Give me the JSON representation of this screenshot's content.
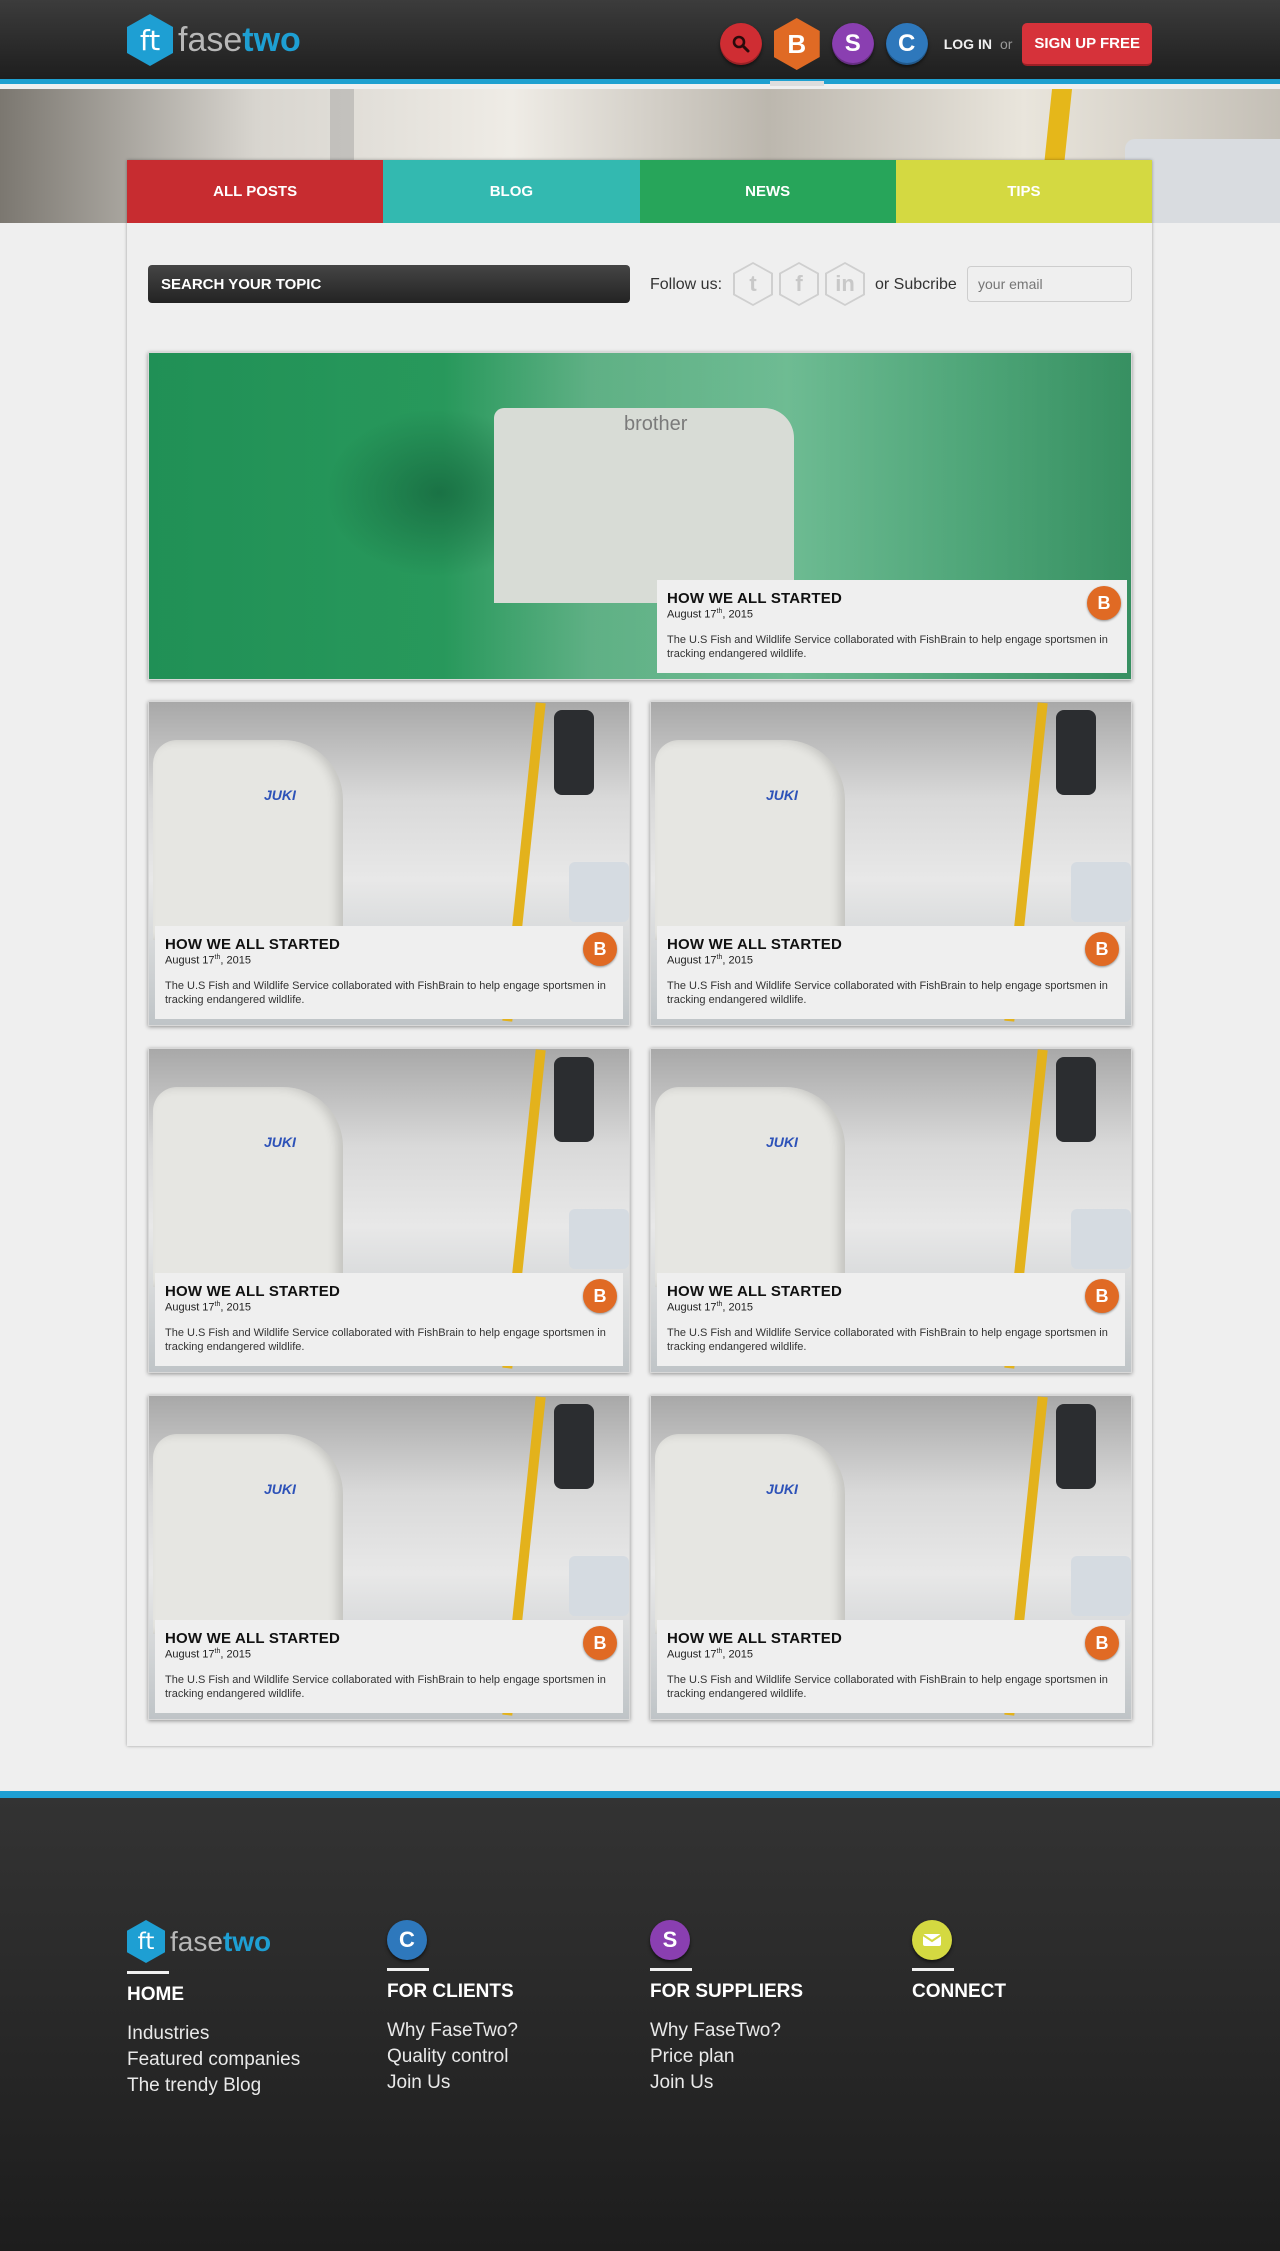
{
  "brand": {
    "logo_mark": "ft",
    "name_part1": "fase",
    "name_part2": "two"
  },
  "header": {
    "search_icon": "search-icon",
    "badges": {
      "blog": "B",
      "suppliers": "S",
      "clients": "C"
    },
    "login_label": "LOG IN",
    "or_label": "or",
    "signup_label": "SIGN UP FREE"
  },
  "nav": {
    "tabs": [
      {
        "label": "ALL POSTS",
        "color": "#c72c30"
      },
      {
        "label": "BLOG",
        "color": "#33b9b0"
      },
      {
        "label": "NEWS",
        "color": "#27a55a"
      },
      {
        "label": "TIPS",
        "color": "#d4d941"
      }
    ]
  },
  "toolbar": {
    "search_label": "SEARCH YOUR TOPIC",
    "follow_label": "Follow us:",
    "social": [
      "twitter-icon",
      "facebook-icon",
      "linkedin-icon"
    ],
    "subscribe_label": "or Subcribe",
    "email_placeholder": "your email"
  },
  "feature_post": {
    "title": "HOW WE ALL STARTED",
    "date_day": "August 17",
    "date_suffix": "th",
    "date_year": ", 2015",
    "excerpt": "The U.S Fish and Wildlife Service collaborated with FishBrain to help engage sportsmen in tracking endangered wildlife.",
    "badge": "B",
    "image_text": "brother"
  },
  "posts": [
    {
      "title": "HOW WE ALL STARTED",
      "date_day": "August 17",
      "date_suffix": "th",
      "date_year": ", 2015",
      "excerpt": "The U.S Fish and Wildlife Service collaborated with FishBrain to help engage sportsmen in tracking endangered wildlife.",
      "badge": "B",
      "image_text": "JUKI"
    },
    {
      "title": "HOW WE ALL STARTED",
      "date_day": "August 17",
      "date_suffix": "th",
      "date_year": ", 2015",
      "excerpt": "The U.S Fish and Wildlife Service collaborated with FishBrain to help engage sportsmen in tracking endangered wildlife.",
      "badge": "B",
      "image_text": "JUKI"
    },
    {
      "title": "HOW WE ALL STARTED",
      "date_day": "August 17",
      "date_suffix": "th",
      "date_year": ", 2015",
      "excerpt": "The U.S Fish and Wildlife Service collaborated with FishBrain to help engage sportsmen in tracking endangered wildlife.",
      "badge": "B",
      "image_text": "JUKI"
    },
    {
      "title": "HOW WE ALL STARTED",
      "date_day": "August 17",
      "date_suffix": "th",
      "date_year": ", 2015",
      "excerpt": "The U.S Fish and Wildlife Service collaborated with FishBrain to help engage sportsmen in tracking endangered wildlife.",
      "badge": "B",
      "image_text": "JUKI"
    },
    {
      "title": "HOW WE ALL STARTED",
      "date_day": "August 17",
      "date_suffix": "th",
      "date_year": ", 2015",
      "excerpt": "The U.S Fish and Wildlife Service collaborated with FishBrain to help engage sportsmen in tracking endangered wildlife.",
      "badge": "B",
      "image_text": "JUKI"
    },
    {
      "title": "HOW WE ALL STARTED",
      "date_day": "August 17",
      "date_suffix": "th",
      "date_year": ", 2015",
      "excerpt": "The U.S Fish and Wildlife Service collaborated with FishBrain to help engage sportsmen in tracking endangered wildlife.",
      "badge": "B",
      "image_text": "JUKI"
    }
  ],
  "footer": {
    "columns": [
      {
        "heading": "HOME",
        "links": [
          "Industries",
          "Featured companies",
          "The trendy Blog"
        ]
      },
      {
        "icon": "C",
        "heading": "FOR CLIENTS",
        "links": [
          "Why FaseTwo?",
          "Quality control",
          "Join Us"
        ],
        "color": "#2e78bc"
      },
      {
        "icon": "S",
        "heading": "FOR SUPPLIERS",
        "links": [
          "Why FaseTwo?",
          "Price plan",
          "Join Us"
        ],
        "color": "#8a3fb1"
      },
      {
        "icon": "envelope-icon",
        "heading": "CONNECT",
        "links": [],
        "color": "#d4d941"
      }
    ]
  },
  "colors": {
    "accent_blue": "#1e9fd3",
    "signup_red": "#d6323a",
    "badge_orange": "#e06a24"
  }
}
